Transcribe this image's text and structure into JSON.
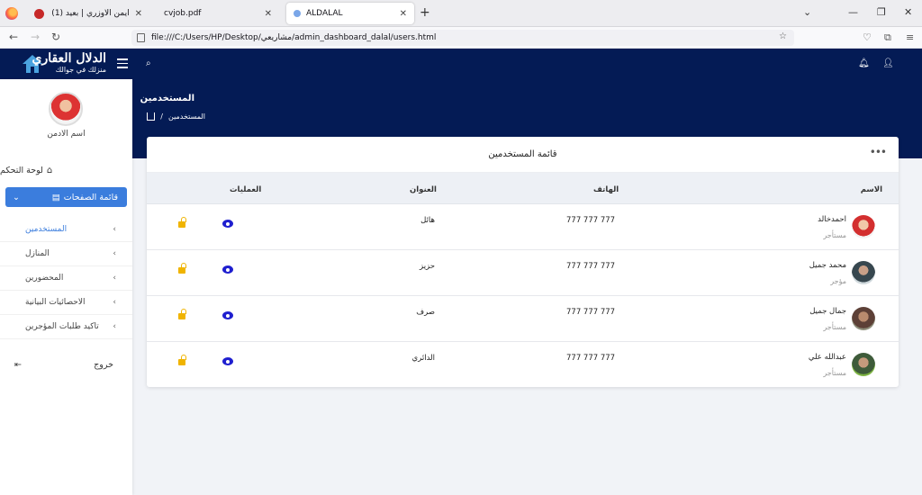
{
  "browser": {
    "tabs": [
      {
        "title": "أيمن الاوزري | بعيد (1)",
        "active": false
      },
      {
        "title": "cvjob.pdf",
        "active": false
      },
      {
        "title": "ALDALAL",
        "active": true
      }
    ],
    "url": "file:///C:/Users/HP/Desktop/مشاريعي/admin_dashboard_dalal/users.html"
  },
  "brand": {
    "line1": "الدلال العقاري",
    "line2": "منزلك في جوالك"
  },
  "header": {
    "page_title": "المستخدمين",
    "breadcrumb_current": "المستخدمين"
  },
  "sidebar": {
    "admin_name": "اسم الادمن",
    "dashboard": "لوحة التحكم",
    "pages_menu": "قائمة الصفحات",
    "items": [
      {
        "label": "المستخدمين",
        "active": true
      },
      {
        "label": "المنازل",
        "active": false
      },
      {
        "label": "المحضورين",
        "active": false
      },
      {
        "label": "الاحصائيات البيانية",
        "active": false
      },
      {
        "label": "تاكيد طلبات المؤجرين",
        "active": false
      }
    ],
    "logout": "خروج"
  },
  "card": {
    "title": "قائمة المستخدمين",
    "columns": {
      "name": "الاسم",
      "phone": "الهاتف",
      "address": "العنوان",
      "actions": "العمليات"
    },
    "rows": [
      {
        "name": "احمدخالد",
        "role": "مستأجر",
        "phone": "777 777 777",
        "address": "هائل"
      },
      {
        "name": "محمد جميل",
        "role": "مؤجر",
        "phone": "777 777 777",
        "address": "حزيز"
      },
      {
        "name": "جمال جميل",
        "role": "مستأجر",
        "phone": "777 777 777",
        "address": "صرف"
      },
      {
        "name": "عبدالله علي",
        "role": "مستأجر",
        "phone": "777 777 777",
        "address": "الدائري"
      }
    ]
  },
  "colors": {
    "navy": "#041b55",
    "accent": "#3b7ddd",
    "view": "#1f1fcf",
    "lock": "#f0b400"
  }
}
